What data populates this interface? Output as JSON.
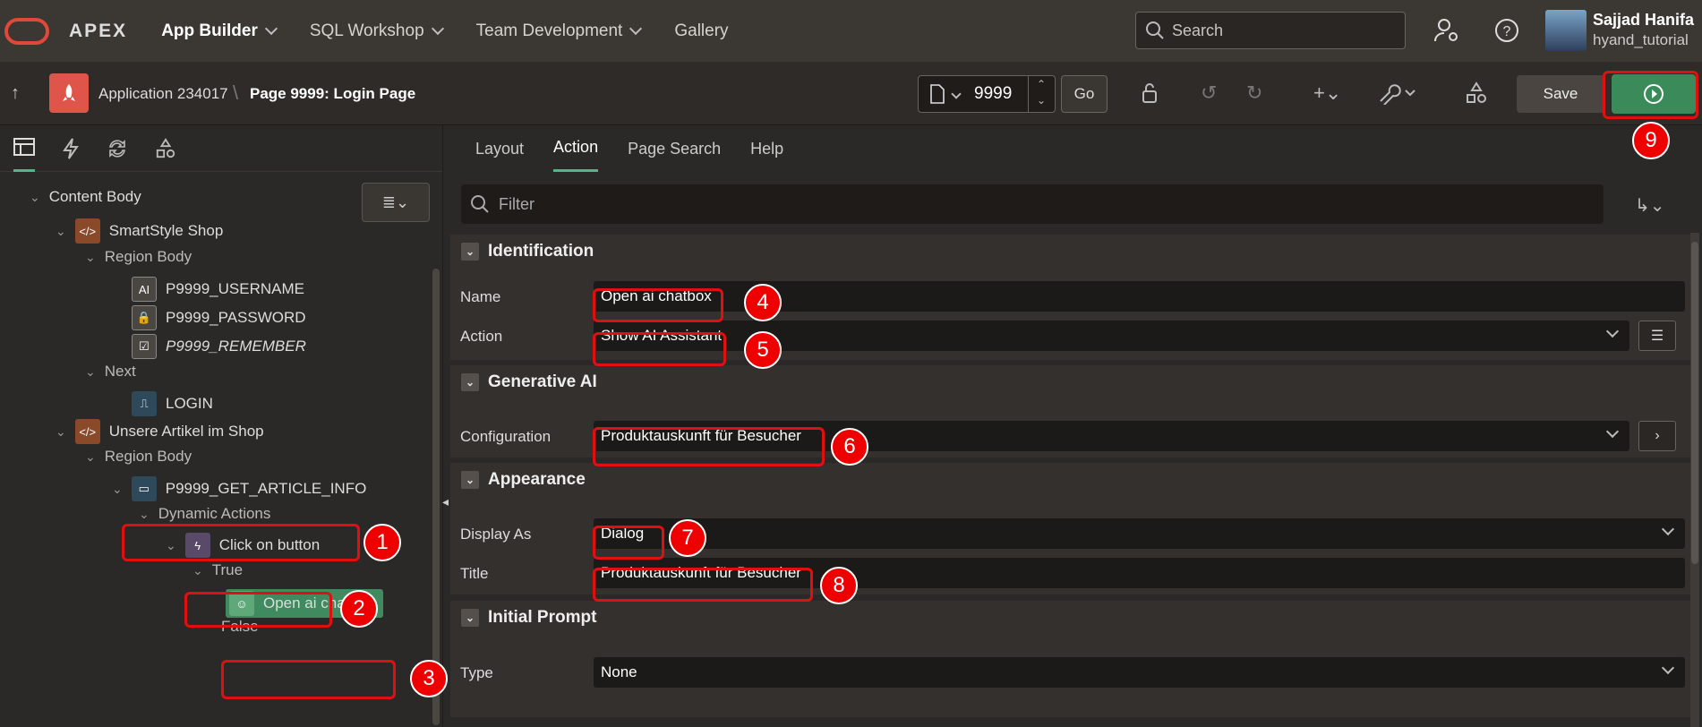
{
  "topnav": {
    "brand": "APEX",
    "items": [
      {
        "label": "App Builder",
        "active": true
      },
      {
        "label": "SQL Workshop"
      },
      {
        "label": "Team Development"
      },
      {
        "label": "Gallery"
      }
    ],
    "search_placeholder": "Search",
    "user_name": "Sajjad Hanifa",
    "user_workspace": "hyand_tutorial"
  },
  "toolbar": {
    "app_crumb": "Application 234017",
    "page_crumb": "Page 9999: Login Page",
    "page_number": "9999",
    "go_label": "Go",
    "save_label": "Save"
  },
  "left_tree": {
    "nodes": [
      {
        "label": "Content Body"
      },
      {
        "label": "SmartStyle Shop",
        "icon": "region-icon"
      },
      {
        "label": "Region Body"
      },
      {
        "label": "P9999_USERNAME",
        "icon": "text-field-icon"
      },
      {
        "label": "P9999_PASSWORD",
        "icon": "password-icon"
      },
      {
        "label": "P9999_REMEMBER",
        "icon": "checkbox-icon"
      },
      {
        "label": "Next"
      },
      {
        "label": "LOGIN",
        "icon": "button-icon"
      },
      {
        "label": "Unsere Artikel im Shop",
        "icon": "region-icon"
      },
      {
        "label": "Region Body"
      },
      {
        "label": "P9999_GET_ARTICLE_INFO",
        "icon": "button-icon"
      },
      {
        "label": "Dynamic Actions"
      },
      {
        "label": "Click on button",
        "icon": "lightning-icon"
      },
      {
        "label": "True"
      },
      {
        "label": "Open ai chatbox",
        "icon": "ai-icon"
      },
      {
        "label": "False"
      }
    ]
  },
  "right": {
    "tabs": [
      "Layout",
      "Action",
      "Page Search",
      "Help"
    ],
    "active_tab": "Action",
    "filter_placeholder": "Filter",
    "sections": {
      "identification": {
        "title": "Identification",
        "name_label": "Name",
        "name_value": "Open ai chatbox",
        "action_label": "Action",
        "action_value": "Show AI Assistant"
      },
      "genai": {
        "title": "Generative AI",
        "config_label": "Configuration",
        "config_value": "Produktauskunft für Besucher"
      },
      "appearance": {
        "title": "Appearance",
        "display_label": "Display As",
        "display_value": "Dialog",
        "title_label": "Title",
        "title_value": "Produktauskunft für Besucher"
      },
      "prompt": {
        "title": "Initial Prompt",
        "type_label": "Type",
        "type_value": "None"
      }
    }
  },
  "annotations": [
    "1",
    "2",
    "3",
    "4",
    "5",
    "6",
    "7",
    "8",
    "9"
  ],
  "colors": {
    "accent": "#4db88a",
    "highlight": "#e01010",
    "run": "#3a8a5a",
    "app_icon": "#e05549"
  }
}
